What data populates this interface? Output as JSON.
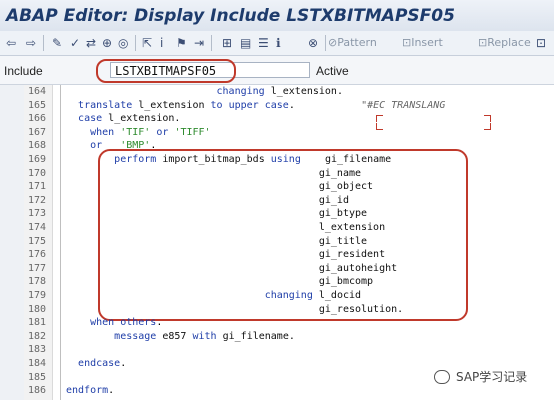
{
  "window": {
    "title": "ABAP Editor: Display Include LSTXBITMAPSF05"
  },
  "toolbar": {
    "items": [
      {
        "name": "back-icon",
        "glyph": "⇦",
        "label": ""
      },
      {
        "name": "forward-icon",
        "glyph": "⇨",
        "label": ""
      },
      {
        "name": "edit-pencil-icon",
        "glyph": "✎",
        "label": ""
      },
      {
        "name": "check-icon",
        "glyph": "✓",
        "label": ""
      },
      {
        "name": "compare-icon",
        "glyph": "⇄",
        "label": ""
      },
      {
        "name": "test-icon",
        "glyph": "⊕",
        "label": ""
      },
      {
        "name": "activate-icon",
        "glyph": "◎",
        "label": ""
      },
      {
        "name": "where-used-icon",
        "glyph": "⇱",
        "label": ""
      },
      {
        "name": "info-icon",
        "glyph": "i",
        "label": ""
      },
      {
        "name": "object-list-icon",
        "glyph": "⚑",
        "label": ""
      },
      {
        "name": "navigation-icon",
        "glyph": "⇥",
        "label": ""
      },
      {
        "name": "hierarchy-icon",
        "glyph": "⊞",
        "label": ""
      },
      {
        "name": "display-object-icon",
        "glyph": "▤",
        "label": ""
      },
      {
        "name": "print-icon",
        "glyph": "☰",
        "label": ""
      },
      {
        "name": "help-icon",
        "glyph": "ℹ",
        "label": ""
      },
      {
        "name": "stop-icon",
        "glyph": "⊗",
        "label": ""
      },
      {
        "name": "pattern-icon",
        "glyph": "⊘",
        "label": "Pattern"
      },
      {
        "name": "insert-icon",
        "glyph": "⊡",
        "label": "Insert"
      },
      {
        "name": "replace-icon",
        "glyph": "⊡",
        "label": "Replace"
      },
      {
        "name": "more-icon",
        "glyph": "⊡",
        "label": ""
      }
    ]
  },
  "infobar": {
    "label": "Include",
    "program": "LSTXBITMAPSF05",
    "status": "Active"
  },
  "editor": {
    "lines": [
      {
        "n": "164",
        "html": "                         <span class='kw'>changing</span> <span class='id'>l_extension.</span>"
      },
      {
        "n": "165",
        "html": "  <span class='kw'>translate</span> <span class='id'>l_extension</span> <span class='kw'>to upper case</span>.           <span class='cm'>\"#EC TRANSLANG</span>"
      },
      {
        "n": "166",
        "html": "  <span class='kw'>case</span> <span class='id'>l_extension.</span>"
      },
      {
        "n": "167",
        "html": "    <span class='kw'>when</span> <span class='str'>'TIF'</span> <span class='kw'>or</span> <span class='str'>'TIFF'</span>"
      },
      {
        "n": "168",
        "html": "    <span class='kw'>or</span>   <span class='str'>'BMP'</span>."
      },
      {
        "n": "169",
        "html": "        <span class='kw'>perform</span> <span class='id'>import_bitmap_bds</span> <span class='kw'>using</span>    <span class='id'>gi_filename</span>"
      },
      {
        "n": "170",
        "html": "                                          <span class='id'>gi_name</span>"
      },
      {
        "n": "171",
        "html": "                                          <span class='id'>gi_object</span>"
      },
      {
        "n": "172",
        "html": "                                          <span class='id'>gi_id</span>"
      },
      {
        "n": "173",
        "html": "                                          <span class='id'>gi_btype</span>"
      },
      {
        "n": "174",
        "html": "                                          <span class='id'>l_extension</span>"
      },
      {
        "n": "175",
        "html": "                                          <span class='id'>gi_title</span>"
      },
      {
        "n": "176",
        "html": "                                          <span class='id'>gi_resident</span>"
      },
      {
        "n": "177",
        "html": "                                          <span class='id'>gi_autoheight</span>"
      },
      {
        "n": "178",
        "html": "                                          <span class='id'>gi_bmcomp</span>"
      },
      {
        "n": "179",
        "html": "                                 <span class='kw'>changing</span> <span class='id'>l_docid</span>"
      },
      {
        "n": "180",
        "html": "                                          <span class='id'>gi_resolution.</span>"
      },
      {
        "n": "181",
        "html": "    <span class='kw'>when others</span>."
      },
      {
        "n": "182",
        "html": "        <span class='kw'>message</span> <span class='id'>e857</span> <span class='kw'>with</span> <span class='id'>gi_filename.</span>"
      },
      {
        "n": "183",
        "html": ""
      },
      {
        "n": "184",
        "html": "  <span class='kw'>endcase</span>."
      },
      {
        "n": "185",
        "html": ""
      },
      {
        "n": "186",
        "html": "<span class='kw'>endform</span>."
      }
    ]
  },
  "watermark": {
    "text": "SAP学习记录"
  },
  "colors": {
    "annotation": "#c0392b",
    "keyword": "#1f3ea8",
    "string": "#2e8b2e"
  }
}
